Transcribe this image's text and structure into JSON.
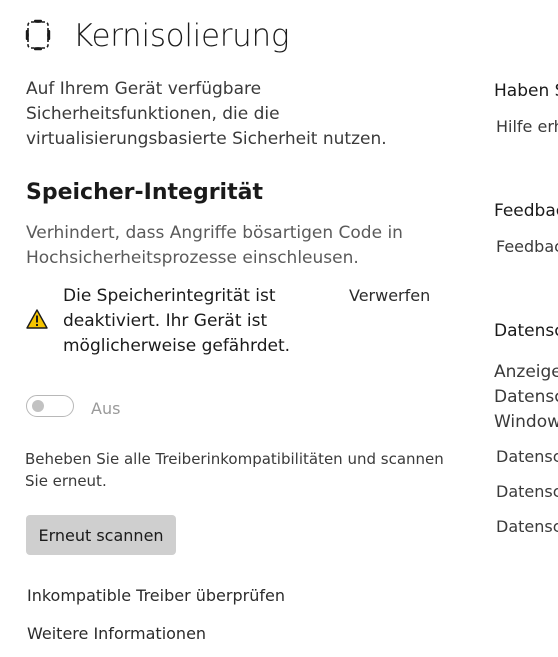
{
  "header": {
    "title": "Kernisolierung",
    "icon": "core-isolation-icon"
  },
  "intro": "Auf Ihrem Gerät verfügbare Sicherheitsfunktionen, die die virtualisierungsbasierte Sicherheit nutzen.",
  "memory_integrity": {
    "title": "Speicher-Integrität",
    "description": "Verhindert, dass Angriffe bösartigen Code in Hochsicherheitsprozesse einschleusen.",
    "warning": {
      "icon": "warning-icon",
      "color": "#f5c400",
      "text": "Die Speicherintegrität ist deaktiviert. Ihr Gerät ist möglicherweise gefährdet.",
      "dismiss_label": "Verwerfen"
    },
    "toggle": {
      "state": "off",
      "label": "Aus"
    },
    "fix_text": "Beheben Sie alle Treiberinkompatibilitäten und scannen Sie erneut.",
    "rescan_label": "Erneut scannen",
    "links": [
      "Inkompatible Treiber überprüfen",
      "Weitere Informationen"
    ]
  },
  "right_column": {
    "question_heading": "Haben S",
    "help_link": "Hilfe erh",
    "feedback_heading": "Feedbac",
    "feedback_link": "Feedbac",
    "privacy_heading": "Datensc",
    "privacy_text": "Anzeige\nDatensc\nWindow",
    "privacy_links": [
      "Datensc",
      "Datensc",
      "Datensc"
    ]
  }
}
